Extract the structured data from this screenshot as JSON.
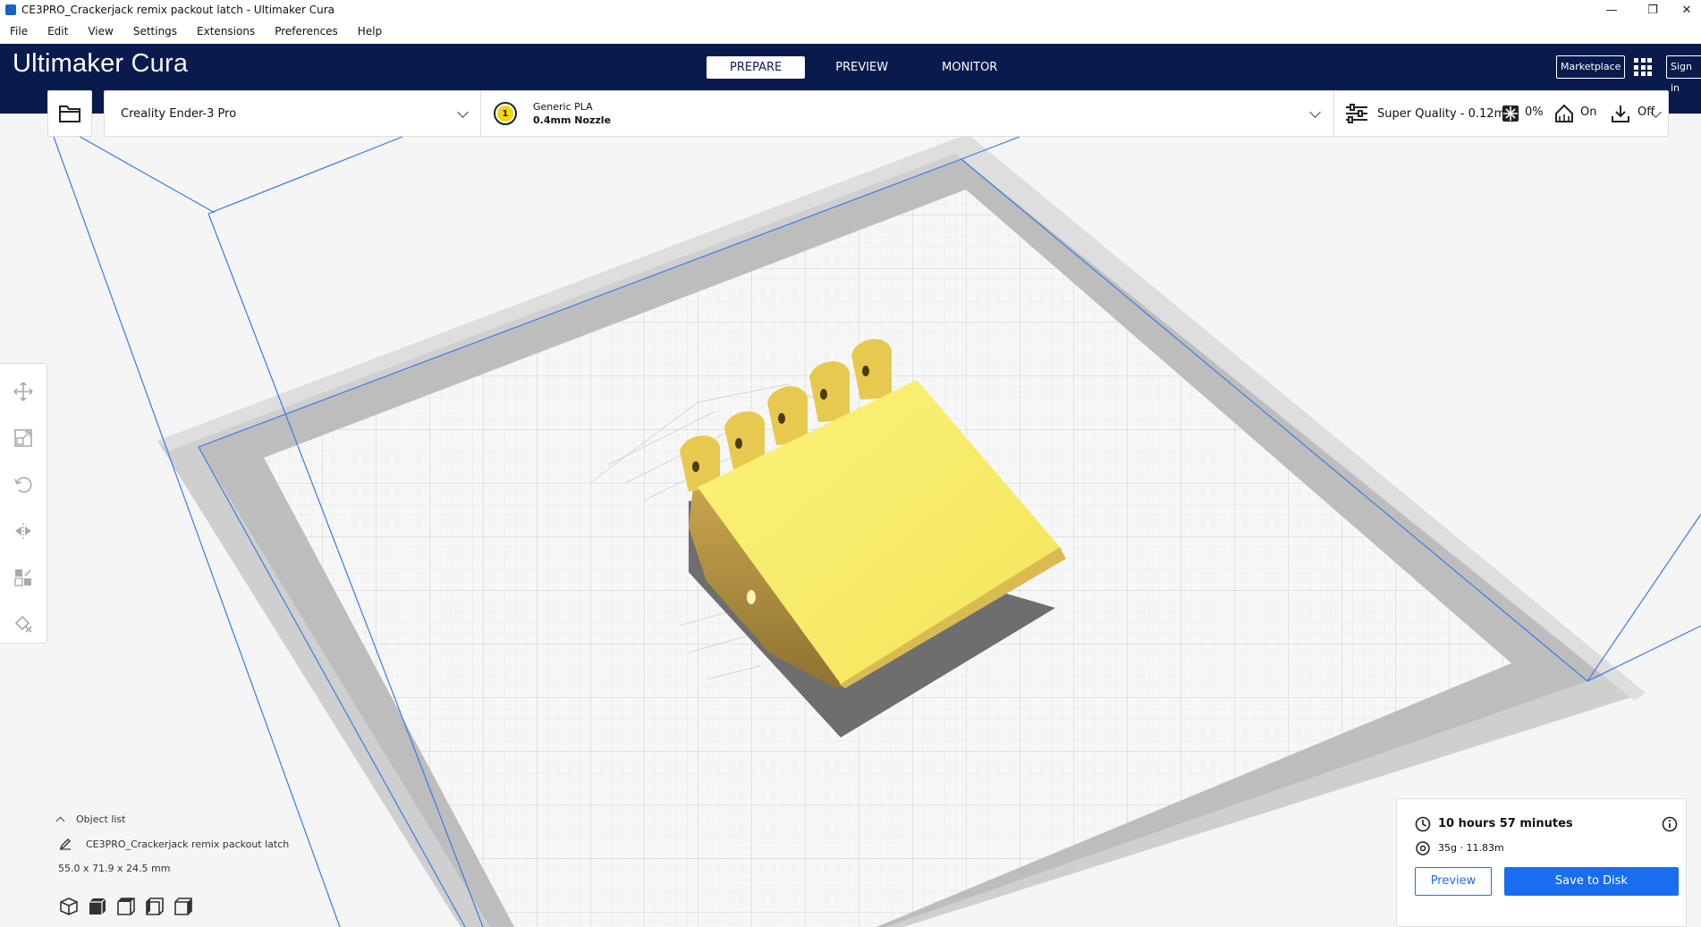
{
  "window": {
    "title": "CE3PRO_Crackerjack remix packout latch - Ultimaker Cura",
    "controls": {
      "minimize": "—",
      "maximize": "❐",
      "close": "✕"
    }
  },
  "menu": [
    "File",
    "Edit",
    "View",
    "Settings",
    "Extensions",
    "Preferences",
    "Help"
  ],
  "header": {
    "logo_part1": "Ultimaker",
    "logo_part2": "Cura",
    "stages": [
      "PREPARE",
      "PREVIEW",
      "MONITOR"
    ],
    "active_stage": "PREPARE",
    "marketplace": "Marketplace",
    "signin": "Sign in"
  },
  "toolbar": {
    "printer": "Creality Ender-3 Pro",
    "extruder_number": "1",
    "material": "Generic PLA",
    "nozzle": "0.4mm Nozzle",
    "profile": "Super Quality - 0.12mm",
    "infill": "0%",
    "support": "On",
    "adhesion": "Off"
  },
  "tools": [
    "move-icon",
    "scale-icon",
    "rotate-icon",
    "mirror-icon",
    "per-model-settings-icon",
    "support-blocker-icon"
  ],
  "object_list": {
    "header": "Object list",
    "object_name": "CE3PRO_Crackerjack remix packout latch",
    "dimensions": "55.0 x 71.9 x 24.5 mm"
  },
  "print_info": {
    "time": "10 hours 57 minutes",
    "material_usage": "35g · 11.83m",
    "preview_button": "Preview",
    "save_button": "Save to Disk"
  },
  "colors": {
    "header_bg": "#0a1a4d",
    "accent": "#196ef0",
    "model_yellow": "#f7ec6e"
  }
}
